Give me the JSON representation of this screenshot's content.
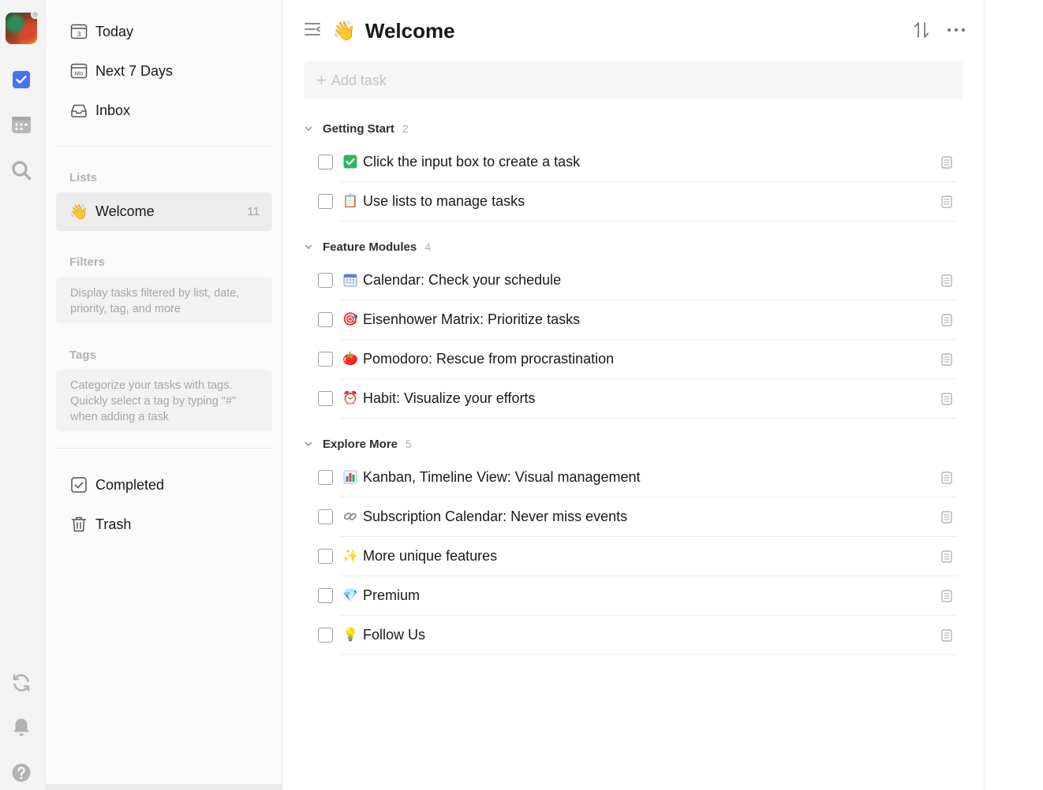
{
  "colors": {
    "accent": "#4772fa",
    "rail_bg": "#f3f3f3",
    "sidebar_bg": "#fafafa",
    "active_bg": "#ececec"
  },
  "rail": {
    "icons": [
      "avatar",
      "task-checkbox-icon",
      "calendar-grid-icon",
      "search-icon",
      "sync-icon",
      "bell-icon",
      "help-icon"
    ]
  },
  "sidebar": {
    "smart_lists": [
      {
        "label": "Today",
        "icon": "calendar-today-icon",
        "icon_text": "3"
      },
      {
        "label": "Next 7 Days",
        "icon": "calendar-week-icon",
        "icon_text": "Mo"
      },
      {
        "label": "Inbox",
        "icon": "inbox-icon"
      }
    ],
    "lists_title": "Lists",
    "lists": [
      {
        "label": "Welcome",
        "emoji": "👋",
        "count": "11",
        "active": true
      }
    ],
    "filters_title": "Filters",
    "filters_hint": "Display tasks filtered by list, date, priority, tag, and more",
    "tags_title": "Tags",
    "tags_hint": "Categorize your tasks with tags. Quickly select a tag by typing \"#\" when adding a task",
    "bottom": [
      {
        "label": "Completed",
        "icon": "completed-icon"
      },
      {
        "label": "Trash",
        "icon": "trash-icon"
      }
    ]
  },
  "main": {
    "title_emoji": "👋",
    "title": "Welcome",
    "add_task_placeholder": "Add task",
    "groups": [
      {
        "name": "Getting Start",
        "count": "2",
        "tasks": [
          {
            "emoji": "✅",
            "title": "Click the input box to create a task"
          },
          {
            "emoji": "📋",
            "title": "Use lists to manage tasks"
          }
        ]
      },
      {
        "name": "Feature Modules",
        "count": "4",
        "tasks": [
          {
            "emoji": "📅",
            "title": "Calendar: Check your schedule"
          },
          {
            "emoji": "🎯",
            "title": "Eisenhower Matrix: Prioritize tasks"
          },
          {
            "emoji": "🍅",
            "title": "Pomodoro: Rescue from procrastination"
          },
          {
            "emoji": "⏰",
            "title": "Habit: Visualize your efforts"
          }
        ]
      },
      {
        "name": "Explore More",
        "count": "5",
        "tasks": [
          {
            "emoji": "📊",
            "title": "Kanban, Timeline View: Visual management"
          },
          {
            "emoji": "🔗",
            "title": "Subscription Calendar: Never miss events"
          },
          {
            "emoji": "✨",
            "title": "More unique features"
          },
          {
            "emoji": "💎",
            "title": "Premium"
          },
          {
            "emoji": "💡",
            "title": "Follow Us"
          }
        ]
      }
    ]
  }
}
